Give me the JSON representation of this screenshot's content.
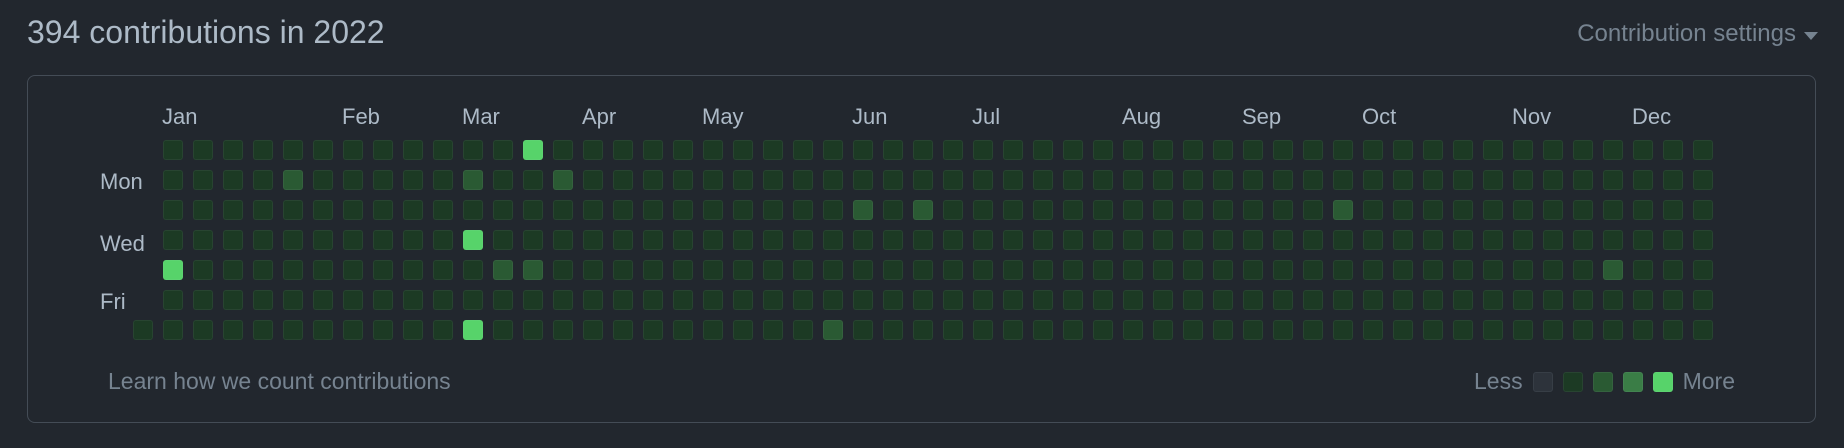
{
  "header": {
    "title": "394 contributions in 2022",
    "settings_label": "Contribution settings"
  },
  "calendar": {
    "months": [
      "Jan",
      "Feb",
      "Mar",
      "Apr",
      "May",
      "Jun",
      "Jul",
      "Aug",
      "Sep",
      "Oct",
      "Nov",
      "Dec"
    ],
    "weekday_labels": [
      "Mon",
      "Wed",
      "Fri"
    ],
    "week_count": 53,
    "levels_colors": [
      "#2d333b",
      "#0e4429",
      "#006d32",
      "#26a641",
      "#39d353"
    ],
    "theme_colors": {
      "level0": "#2d333b",
      "level1": "#1c3a24",
      "level2": "#2a5a33",
      "level3": "#3a7d46",
      "level4": "#57d36a"
    },
    "highlights": [
      {
        "week": 0,
        "day": 4,
        "level": 4
      },
      {
        "week": 4,
        "day": 1,
        "level": 2
      },
      {
        "week": 10,
        "day": 1,
        "level": 2
      },
      {
        "week": 10,
        "day": 3,
        "level": 4
      },
      {
        "week": 10,
        "day": 6,
        "level": 4
      },
      {
        "week": 11,
        "day": 4,
        "level": 2
      },
      {
        "week": 12,
        "day": 0,
        "level": 4
      },
      {
        "week": 12,
        "day": 4,
        "level": 2
      },
      {
        "week": 13,
        "day": 1,
        "level": 2
      },
      {
        "week": 22,
        "day": 6,
        "level": 2
      },
      {
        "week": 23,
        "day": 2,
        "level": 2
      },
      {
        "week": 25,
        "day": 2,
        "level": 2
      },
      {
        "week": 39,
        "day": 2,
        "level": 2
      },
      {
        "week": 48,
        "day": 4,
        "level": 2
      }
    ]
  },
  "footer": {
    "learn_link": "Learn how we count contributions",
    "legend_less": "Less",
    "legend_more": "More"
  }
}
